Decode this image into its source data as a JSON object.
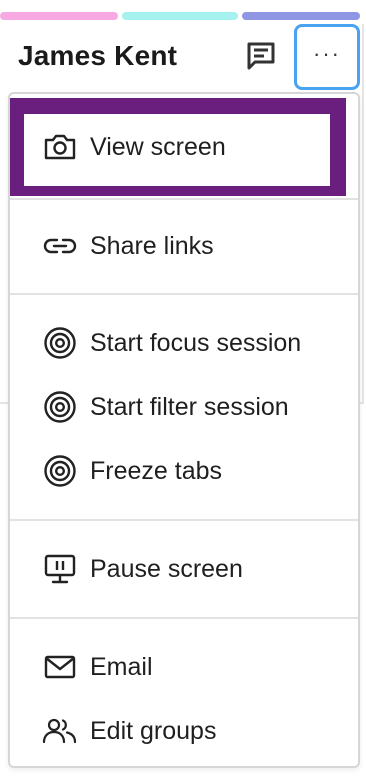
{
  "header": {
    "title": "James Kent",
    "more_label": "···"
  },
  "colors": {
    "strip": [
      "#f6a9e2",
      "#a6f2ee",
      "#8f96e4"
    ],
    "focus": "#6a1f7e",
    "accent": "#4aa3f0"
  },
  "icons": {
    "chat": "chat-bubble-icon",
    "more": "more-horizontal-icon"
  },
  "menu": {
    "items": [
      {
        "label": "View screen",
        "icon": "camera-icon"
      },
      {
        "label": "Share links",
        "icon": "link-icon"
      },
      {
        "label": "Start focus session",
        "icon": "target-icon"
      },
      {
        "label": "Start filter session",
        "icon": "target-icon"
      },
      {
        "label": "Freeze tabs",
        "icon": "target-icon"
      },
      {
        "label": "Pause screen",
        "icon": "monitor-pause-icon"
      },
      {
        "label": "Email",
        "icon": "mail-icon"
      },
      {
        "label": "Edit groups",
        "icon": "users-icon"
      }
    ]
  }
}
